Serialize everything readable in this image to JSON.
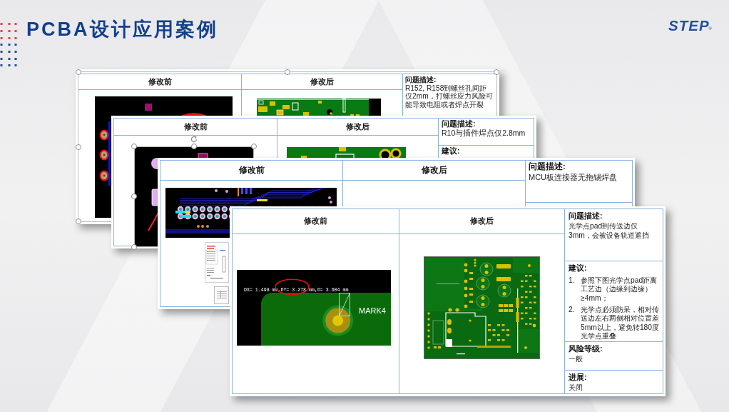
{
  "header": {
    "title": "PCBA设计应用案例",
    "logo": "STEP",
    "logo_mark": "®"
  },
  "cards": [
    {
      "selected": true,
      "image_selected": false,
      "columns": [
        "修改前",
        "修改后"
      ],
      "details": [
        {
          "label": "问题描述:",
          "text": "R152, R158到螺丝孔间距仅2mm，打螺丝应力风险可能导致电阻或者焊点开裂"
        }
      ]
    },
    {
      "selected": false,
      "image_selected": true,
      "columns": [
        "修改前",
        "修改后"
      ],
      "details": [
        {
          "label": "问题描述:",
          "text": "R10与插件焊点仅2.8mm"
        },
        {
          "label": "建议:"
        }
      ]
    },
    {
      "selected": false,
      "image_selected": false,
      "columns": [
        "修改前",
        "修改后"
      ],
      "details": [
        {
          "label": "问题描述:",
          "text": "MCU板连接器无拖锡焊盘"
        }
      ]
    },
    {
      "selected": false,
      "image_selected": false,
      "columns": [
        "修改前",
        "修改后"
      ],
      "measurement": {
        "reading": "DX= 1.498 mm,DY= 3.278 mm,D= 3.604 mm",
        "marker": "MARK4"
      },
      "details": [
        {
          "label": "问题描述:",
          "text": "光学点pad到传送边仅3mm，会被设备轨道遮挡"
        },
        {
          "label": "建议:",
          "items": [
            {
              "number": "1.",
              "text": "参照下图光学点pad距离工艺边（边缘到边缘）≥4mm；"
            },
            {
              "number": "2.",
              "text": "光学点必须防呆，相对传送边左右两侧相对位置差5mm以上，避免转180度光学点重叠"
            }
          ]
        },
        {
          "label": "风险等级:",
          "text": "一般"
        },
        {
          "label": "进展:",
          "text": "关闭"
        }
      ]
    }
  ]
}
